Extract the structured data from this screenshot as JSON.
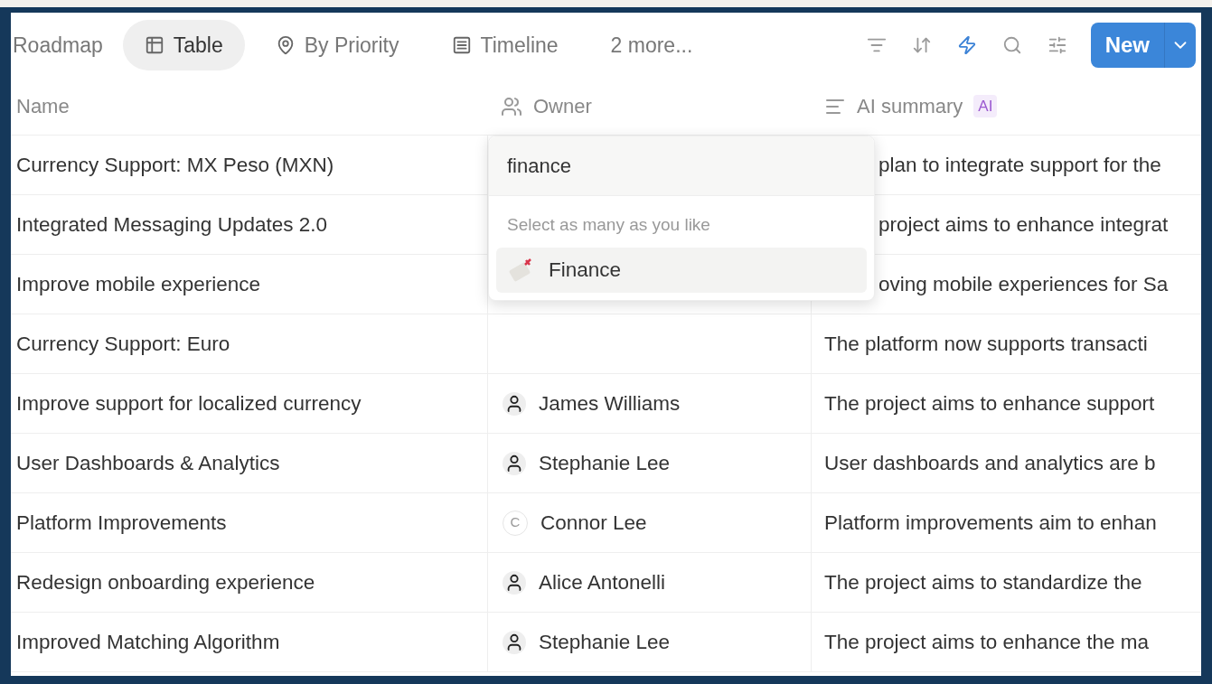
{
  "views": [
    {
      "label": "Roadmap",
      "selected": false
    },
    {
      "label": "Table",
      "selected": true
    },
    {
      "label": "By Priority",
      "selected": false
    },
    {
      "label": "Timeline",
      "selected": false
    },
    {
      "label": "2 more...",
      "selected": false
    }
  ],
  "toolbar": {
    "tools": [
      {
        "kind": "filter",
        "active": false
      },
      {
        "kind": "sort",
        "active": false
      },
      {
        "kind": "automation",
        "active": true
      },
      {
        "kind": "search",
        "active": false
      },
      {
        "kind": "settings",
        "active": false
      }
    ],
    "new_button": "New"
  },
  "table": {
    "columns": [
      {
        "label": "Name"
      },
      {
        "label": "Owner"
      },
      {
        "label": "AI summary",
        "badge": "AI"
      }
    ],
    "rows": [
      {
        "name": "Currency Support: MX Peso (MXN)",
        "summary": "plan to integrate support for the"
      },
      {
        "name": "Integrated Messaging Updates 2.0",
        "summary": "project aims to enhance integrat"
      },
      {
        "name": "Improve mobile experience",
        "summary": "oving mobile experiences for Sa"
      },
      {
        "name": "Currency Support: Euro",
        "summary": "The platform now supports transacti"
      },
      {
        "name": "Improve support for localized currency",
        "owner": {
          "name": "James Williams"
        },
        "summary": "The project aims to enhance support"
      },
      {
        "name": "User Dashboards & Analytics",
        "owner": {
          "name": "Stephanie Lee"
        },
        "summary": "User dashboards and analytics are b"
      },
      {
        "name": "Platform Improvements",
        "owner": {
          "name": "Connor Lee",
          "initial": "C"
        },
        "summary": "Platform improvements aim to enhan"
      },
      {
        "name": "Redesign onboarding experience",
        "owner": {
          "name": "Alice Antonelli"
        },
        "summary": "The project aims to standardize the"
      },
      {
        "name": "Improved Matching Algorithm",
        "owner": {
          "name": "Stephanie Lee"
        },
        "summary": "The project aims to enhance the ma"
      }
    ]
  },
  "owner_picker": {
    "value": "finance",
    "hint": "Select as many as you like",
    "options": [
      {
        "label": "Finance",
        "selected": false
      }
    ]
  }
}
